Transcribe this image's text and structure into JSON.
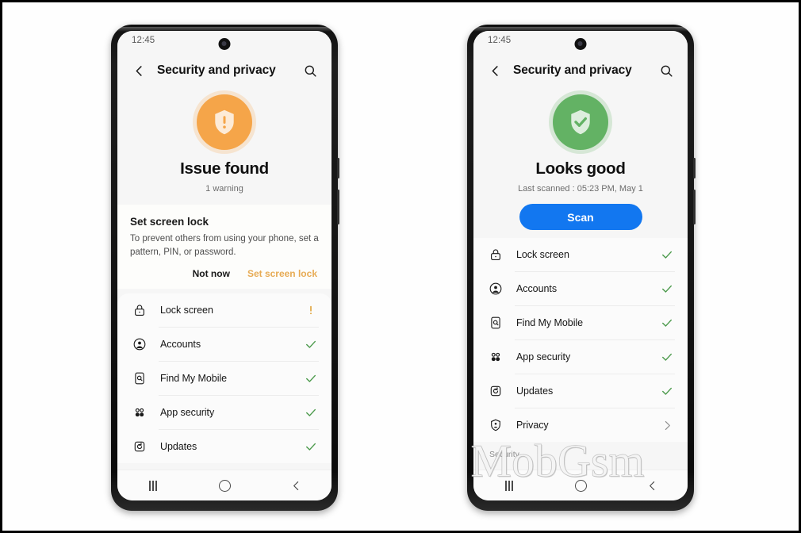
{
  "watermark": "MobGsm",
  "colors": {
    "accent_blue": "#1277f0",
    "warn_orange": "#f5a64a",
    "ok_green": "#63b264",
    "amber_link": "#e7ab54",
    "check_green": "#4c9a4c",
    "screen_bg": "#f6f6f6"
  },
  "phones": [
    {
      "id": "phone-issue-found",
      "status_bar": {
        "time": "12:45"
      },
      "appbar": {
        "back_icon": "chevron-left-icon",
        "title": "Security and privacy",
        "search_icon": "search-icon"
      },
      "hero": {
        "state": "warn",
        "shield_icon": "shield-exclamation-icon",
        "title": "Issue found",
        "subtitle": "1 warning",
        "has_scan_button": false,
        "scan_label": ""
      },
      "card": {
        "title": "Set screen lock",
        "body": "To prevent others from using your phone, set a pattern, PIN, or password.",
        "dismiss_label": "Not now",
        "action_label": "Set screen lock"
      },
      "section_label": "",
      "items": [
        {
          "icon": "lock-icon",
          "label": "Lock screen",
          "trail": "warning"
        },
        {
          "icon": "account-icon",
          "label": "Accounts",
          "trail": "check"
        },
        {
          "icon": "find-my-mobile-icon",
          "label": "Find My Mobile",
          "trail": "check"
        },
        {
          "icon": "app-security-icon",
          "label": "App security",
          "trail": "check"
        },
        {
          "icon": "updates-icon",
          "label": "Updates",
          "trail": "check"
        }
      ],
      "navbar": {
        "recents": "recents-icon",
        "home": "home-icon",
        "back": "back-icon"
      }
    },
    {
      "id": "phone-looks-good",
      "status_bar": {
        "time": "12:45"
      },
      "appbar": {
        "back_icon": "chevron-left-icon",
        "title": "Security and privacy",
        "search_icon": "search-icon"
      },
      "hero": {
        "state": "ok",
        "shield_icon": "shield-check-icon",
        "title": "Looks good",
        "subtitle": "Last scanned : 05:23 PM, May 1",
        "has_scan_button": true,
        "scan_label": "Scan"
      },
      "card": null,
      "section_label": "Security",
      "items": [
        {
          "icon": "lock-icon",
          "label": "Lock screen",
          "trail": "check"
        },
        {
          "icon": "account-icon",
          "label": "Accounts",
          "trail": "check"
        },
        {
          "icon": "find-my-mobile-icon",
          "label": "Find My Mobile",
          "trail": "check"
        },
        {
          "icon": "app-security-icon",
          "label": "App security",
          "trail": "check"
        },
        {
          "icon": "updates-icon",
          "label": "Updates",
          "trail": "check"
        },
        {
          "icon": "privacy-icon",
          "label": "Privacy",
          "trail": "chevron"
        }
      ],
      "navbar": {
        "recents": "recents-icon",
        "home": "home-icon",
        "back": "back-icon"
      }
    }
  ]
}
